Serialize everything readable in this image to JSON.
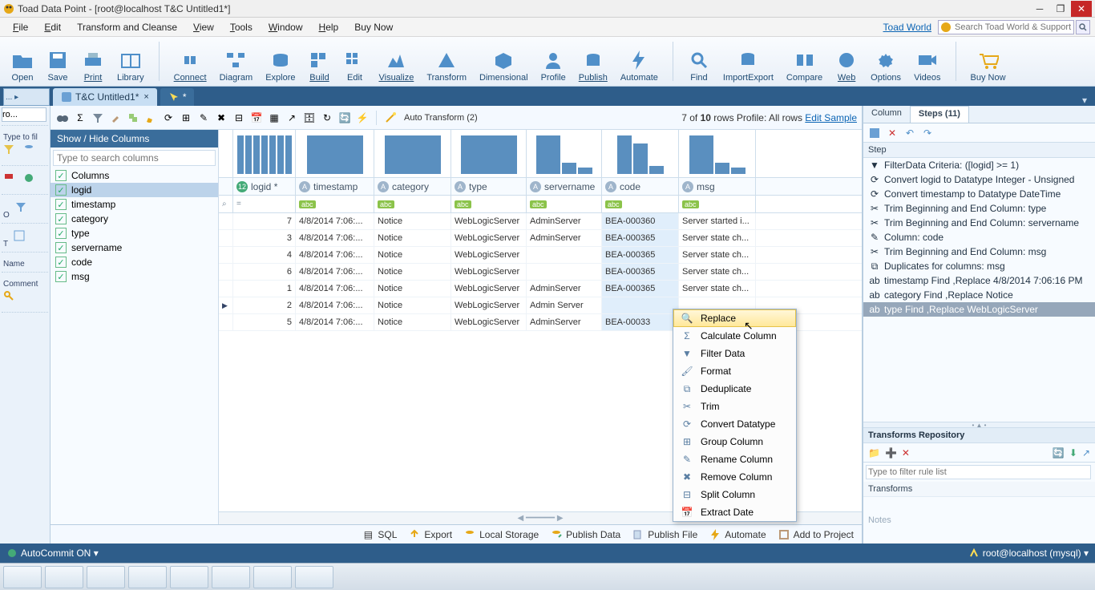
{
  "titlebar": {
    "text": "Toad Data Point - [root@localhost T&C  Untitled1*]"
  },
  "menu": {
    "items": [
      "File",
      "Edit",
      "Transform and Cleanse",
      "View",
      "Tools",
      "Window",
      "Help",
      "Buy Now"
    ],
    "underlines": [
      "F",
      "E",
      "",
      "V",
      "T",
      "W",
      "H",
      ""
    ],
    "toad_world": "Toad World",
    "search_placeholder": "Search Toad World & Support"
  },
  "ribbon": {
    "buttons": [
      {
        "label": "Open"
      },
      {
        "label": "Save"
      },
      {
        "label": "Print"
      },
      {
        "label": "Library"
      },
      {
        "label": "Connect"
      },
      {
        "label": "Diagram"
      },
      {
        "label": "Explore"
      },
      {
        "label": "Build"
      },
      {
        "label": "Edit"
      },
      {
        "label": "Visualize"
      },
      {
        "label": "Transform"
      },
      {
        "label": "Dimensional"
      },
      {
        "label": "Profile"
      },
      {
        "label": "Publish"
      },
      {
        "label": "Automate"
      },
      {
        "label": "Find"
      },
      {
        "label": "ImportExport"
      },
      {
        "label": "Compare"
      },
      {
        "label": "Web"
      },
      {
        "label": "Options"
      },
      {
        "label": "Videos"
      },
      {
        "label": "Buy Now"
      }
    ]
  },
  "tabs": {
    "doc1": "T&C  Untitled1*",
    "doc2": "*"
  },
  "leftrail": {
    "combo": "ro...",
    "type_to_fill": "Type to fil",
    "o": "O",
    "t": "T",
    "name": "Name",
    "comment": "Comment"
  },
  "toolstrip": {
    "auto": "Auto Transform (2)",
    "summary_pre": "7 of ",
    "summary_bold": "10",
    "summary_post": " rows  Profile: All rows ",
    "edit_sample": "Edit Sample"
  },
  "colpanel": {
    "header": "Show / Hide Columns",
    "placeholder": "Type to search columns",
    "items": [
      "Columns",
      "logid",
      "timestamp",
      "category",
      "type",
      "servername",
      "code",
      "msg"
    ]
  },
  "grid": {
    "columns": [
      "logid *",
      "timestamp",
      "category",
      "type",
      "servername",
      "code",
      "msg"
    ],
    "rows": [
      {
        "logid": "7",
        "ts": "4/8/2014 7:06:...",
        "cat": "Notice",
        "type": "WebLogicServer",
        "srv": "AdminServer",
        "code": "BEA-000360",
        "msg": "Server started i..."
      },
      {
        "logid": "3",
        "ts": "4/8/2014 7:06:...",
        "cat": "Notice",
        "type": "WebLogicServer",
        "srv": "AdminServer",
        "code": "BEA-000365",
        "msg": "Server state ch..."
      },
      {
        "logid": "4",
        "ts": "4/8/2014 7:06:...",
        "cat": "Notice",
        "type": "WebLogicServer",
        "srv": "",
        "code": "BEA-000365",
        "msg": "Server state ch..."
      },
      {
        "logid": "6",
        "ts": "4/8/2014 7:06:...",
        "cat": "Notice",
        "type": "WebLogicServer",
        "srv": "",
        "code": "BEA-000365",
        "msg": "Server state ch..."
      },
      {
        "logid": "1",
        "ts": "4/8/2014 7:06:...",
        "cat": "Notice",
        "type": "WebLogicServer",
        "srv": "AdminServer",
        "code": "BEA-000365",
        "msg": "Server state ch..."
      },
      {
        "logid": "2",
        "ts": "4/8/2014 7:06:...",
        "cat": "Notice",
        "type": "WebLogicServer",
        "srv": "Admin Server",
        "code": "",
        "msg": "",
        "current": true
      },
      {
        "logid": "5",
        "ts": "4/8/2014 7:06:...",
        "cat": "Notice",
        "type": "WebLogicServer",
        "srv": "AdminServer",
        "code": "BEA-00033",
        "msg": ""
      }
    ]
  },
  "ctx": {
    "items": [
      "Replace",
      "Calculate Column",
      "Filter Data",
      "Format",
      "Deduplicate",
      "Trim",
      "Convert Datatype",
      "Group Column",
      "Rename Column",
      "Remove Column",
      "Split Column",
      "Extract Date"
    ]
  },
  "right": {
    "tab_column": "Column",
    "tab_steps": "Steps (11)",
    "step_header": "Step",
    "steps": [
      "FilterData Criteria: ([logid] >= 1)",
      "Convert logid to Datatype Integer - Unsigned",
      "Convert timestamp to Datatype DateTime",
      "Trim Beginning and End Column: type",
      "Trim Beginning and End Column: servername",
      " Column: code",
      "Trim Beginning and End Column: msg",
      "Duplicates for columns: msg",
      "timestamp Find ,Replace 4/8/2014 7:06:16 PM",
      "category Find ,Replace Notice",
      "type Find ,Replace WebLogicServer"
    ],
    "repo_header": "Transforms Repository",
    "filter_placeholder": "Type to filter rule list",
    "transforms_label": "Transforms",
    "notes_label": "Notes"
  },
  "actionbar": {
    "sql": "SQL",
    "export": "Export",
    "local": "Local Storage",
    "pubdata": "Publish Data",
    "pubfile": "Publish File",
    "automate": "Automate",
    "addproj": "Add to Project"
  },
  "status": {
    "left": "AutoCommit ON",
    "right": "root@localhost (mysql)"
  }
}
